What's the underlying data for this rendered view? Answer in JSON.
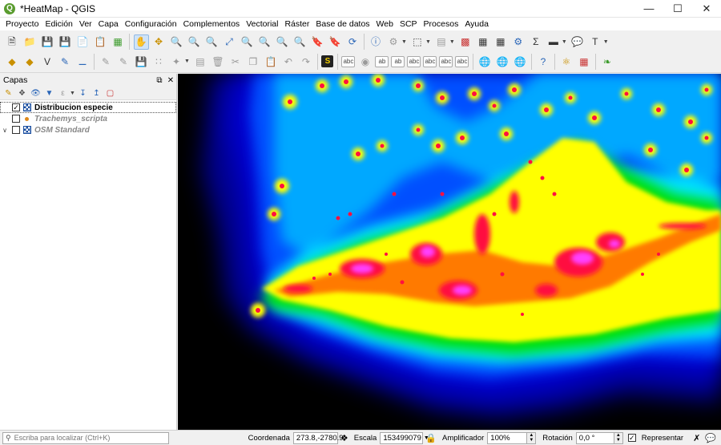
{
  "window": {
    "title": "*HeatMap - QGIS",
    "app_icon": "Q"
  },
  "menu": [
    "Proyecto",
    "Edición",
    "Ver",
    "Capa",
    "Configuración",
    "Complementos",
    "Vectorial",
    "Ráster",
    "Base de datos",
    "Web",
    "SCP",
    "Procesos",
    "Ayuda"
  ],
  "layers_panel": {
    "title": "Capas",
    "layers": [
      {
        "name": "Distribucion especie",
        "checked": true,
        "type": "raster",
        "selected": true
      },
      {
        "name": "Trachemys_scripta",
        "checked": false,
        "type": "point"
      },
      {
        "name": "OSM Standard",
        "checked": false,
        "type": "raster",
        "expandable": true
      }
    ]
  },
  "statusbar": {
    "locator_placeholder": "Escriba para localizar (Ctrl+K)",
    "coord_label": "Coordenada",
    "coord_value": "273.8,-2780.9",
    "scale_label": "Escala",
    "scale_value": "153499079",
    "magnifier_label": "Amplificador",
    "magnifier_value": "100%",
    "rotation_label": "Rotación",
    "rotation_value": "0,0 °",
    "render_label": "Representar",
    "render_checked": true
  },
  "colors": {
    "heat_blue": "#0000c8",
    "heat_cyan": "#00e0ff",
    "heat_green": "#00e000",
    "heat_yellow": "#ffff00",
    "heat_red": "#ff0040",
    "heat_magenta": "#ff40ff"
  }
}
